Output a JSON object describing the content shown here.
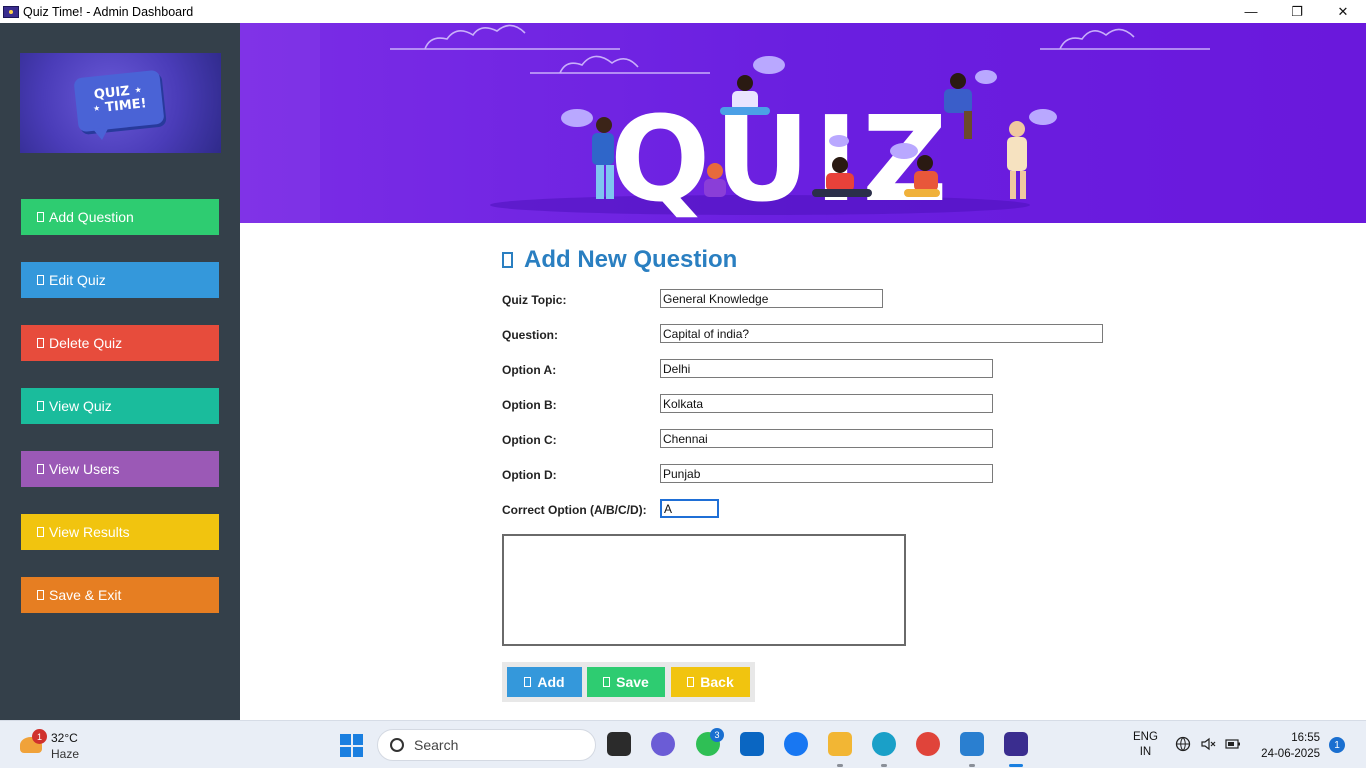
{
  "window": {
    "title": "Quiz Time! - Admin Dashboard",
    "minimize": "—",
    "maximize": "❐",
    "close": "✕"
  },
  "sidebar": {
    "logo_text": "QUIZ ⋆\n⋆ TIME!",
    "items": [
      {
        "label": "Add Question",
        "color": "#2ecc71"
      },
      {
        "label": "Edit Quiz",
        "color": "#3498db"
      },
      {
        "label": "Delete Quiz",
        "color": "#e74c3c"
      },
      {
        "label": "View Quiz",
        "color": "#1abc9c"
      },
      {
        "label": "View Users",
        "color": "#9b59b6"
      },
      {
        "label": "View Results",
        "color": "#f1c40f"
      },
      {
        "label": "Save & Exit",
        "color": "#e67e22"
      }
    ]
  },
  "banner": {
    "word": "QUIZ"
  },
  "form": {
    "heading": "Add New Question",
    "fields": [
      {
        "label": "Quiz Topic:",
        "value": "General Knowledge"
      },
      {
        "label": "Question:",
        "value": "Capital of india?"
      },
      {
        "label": "Option A:",
        "value": "Delhi"
      },
      {
        "label": "Option B:",
        "value": "Kolkata"
      },
      {
        "label": "Option C:",
        "value": "Chennai"
      },
      {
        "label": "Option D:",
        "value": "Punjab"
      },
      {
        "label": "Correct Option (A/B/C/D):",
        "value": "A"
      }
    ],
    "textarea_value": "",
    "buttons": {
      "add": "Add",
      "save": "Save",
      "back": "Back"
    }
  },
  "taskbar": {
    "weather_temp": "32°C",
    "weather_desc": "Haze",
    "weather_badge": "1",
    "search_placeholder": "Search",
    "whatsapp_badge": "3",
    "lang_1": "ENG",
    "lang_2": "IN",
    "time": "16:55",
    "date": "24-06-2025",
    "notifications": "1"
  }
}
